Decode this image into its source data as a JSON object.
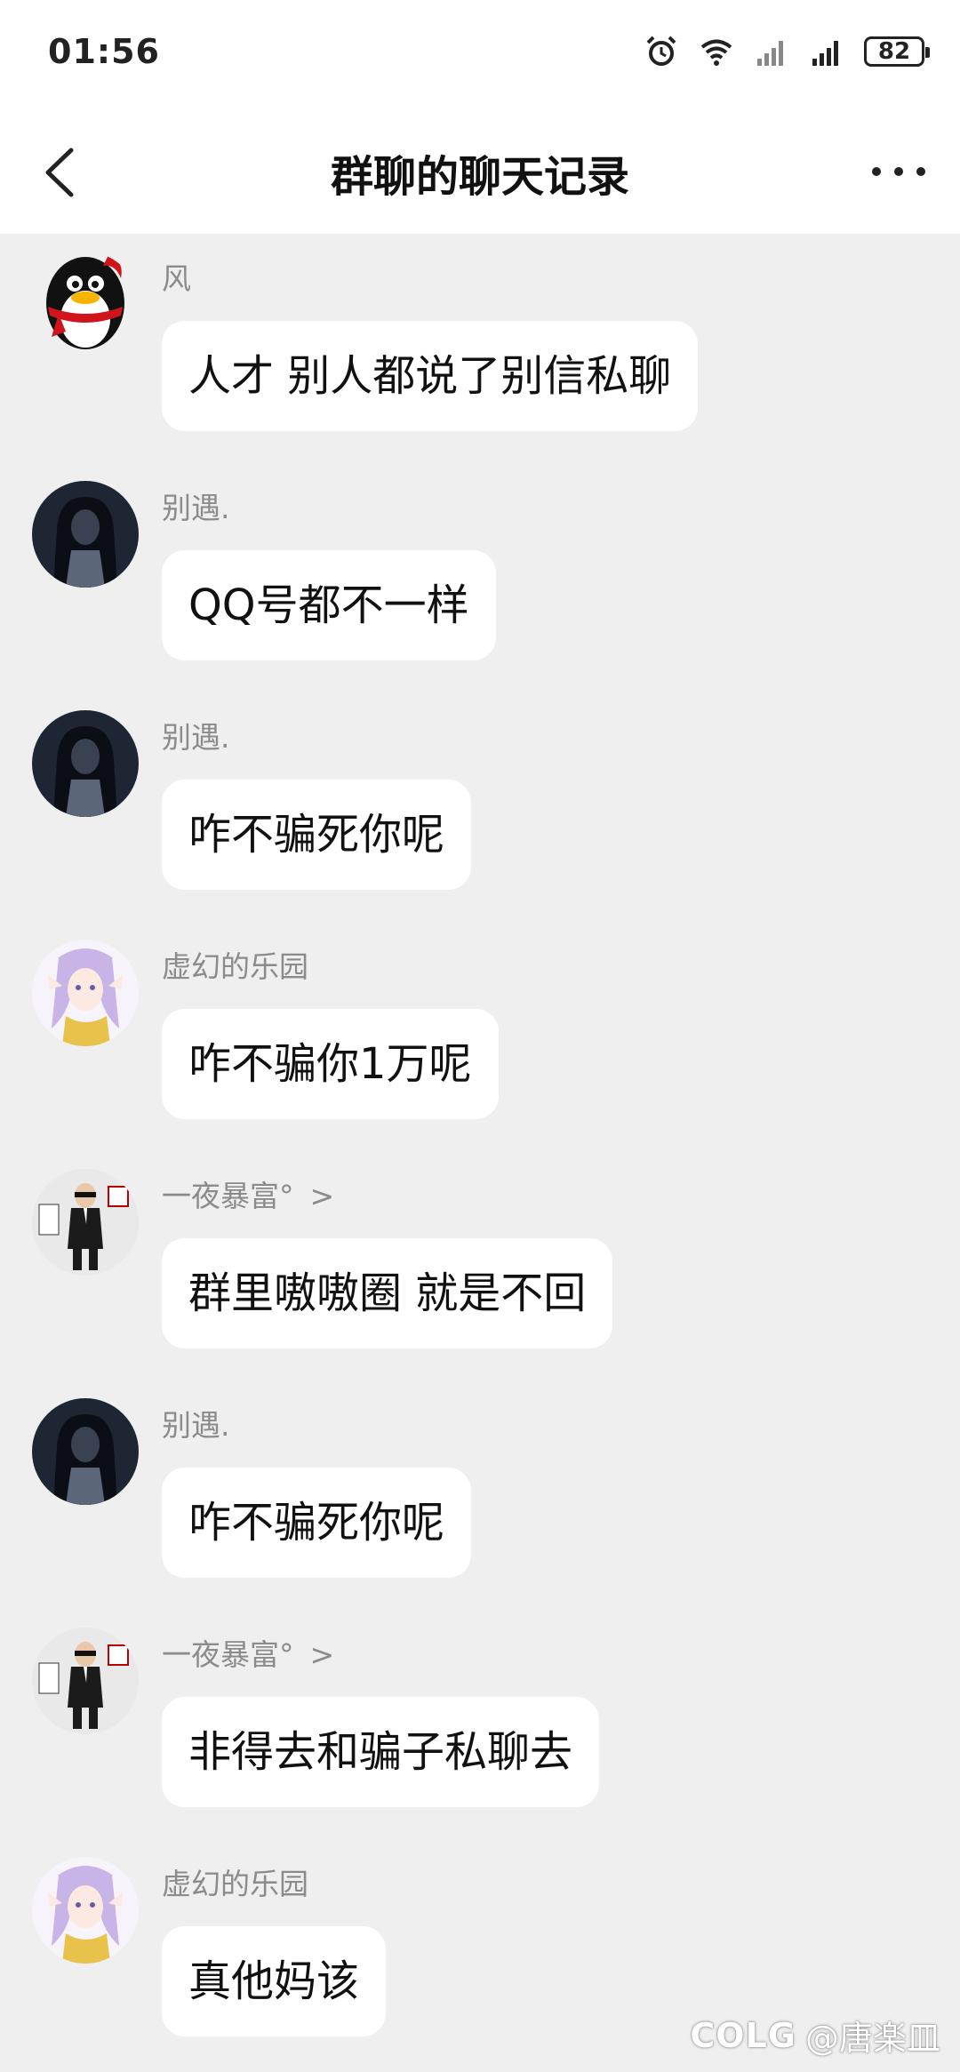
{
  "status_bar": {
    "time": "01:56",
    "battery": "82",
    "icons": [
      "alarm-icon",
      "wifi-icon",
      "signal-icon",
      "signal-icon"
    ]
  },
  "header": {
    "title": "群聊的聊天记录",
    "back_icon": "chevron-left-icon",
    "more_icon": "more-icon"
  },
  "messages": [
    {
      "sender": "风",
      "text": "人才 别人都说了别信私聊",
      "avatar": "penguin",
      "chevron": ""
    },
    {
      "sender": "别遇.",
      "text": "QQ号都不一样",
      "avatar": "hooded",
      "chevron": ""
    },
    {
      "sender": "别遇.",
      "text": "咋不骗死你呢",
      "avatar": "hooded",
      "chevron": ""
    },
    {
      "sender": "虚幻的乐园",
      "text": "咋不骗你1万呢",
      "avatar": "elf",
      "chevron": ""
    },
    {
      "sender": "一夜暴富°",
      "text": "群里嗷嗷圈 就是不回",
      "avatar": "suit",
      "chevron": ">"
    },
    {
      "sender": "别遇.",
      "text": "咋不骗死你呢",
      "avatar": "hooded",
      "chevron": ""
    },
    {
      "sender": "一夜暴富°",
      "text": "非得去和骗子私聊去",
      "avatar": "suit",
      "chevron": ">"
    },
    {
      "sender": "虚幻的乐园",
      "text": "真他妈该",
      "avatar": "elf",
      "chevron": ""
    }
  ],
  "watermark": {
    "logo": "COLG",
    "handle": "@唐楽皿"
  },
  "colors": {
    "background": "#efefef",
    "bubble": "#ffffff",
    "name": "#8b8b8b"
  }
}
